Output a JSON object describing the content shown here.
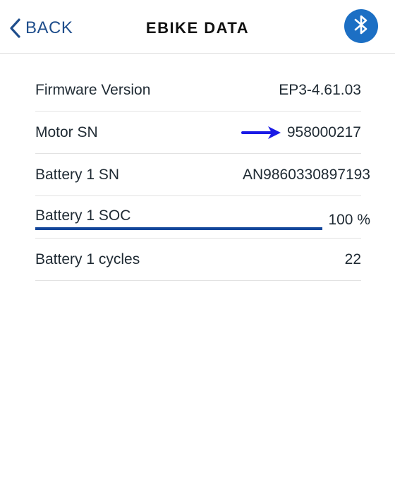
{
  "header": {
    "back_label": "BACK",
    "title": "EBIKE DATA",
    "bluetooth_icon": "bluetooth-icon",
    "accent_color": "#1f4e8c",
    "bluetooth_color": "#1c6fc4"
  },
  "rows": [
    {
      "label": "Firmware Version",
      "value": "EP3-4.61.03"
    },
    {
      "label": "Motor SN",
      "value": "958000217",
      "annotation": "arrow-icon"
    },
    {
      "label": "Battery 1 SN",
      "value": "AN9860330897193"
    },
    {
      "label": "Battery 1 SOC",
      "value": "100 %",
      "level": 1.0
    },
    {
      "label": "Battery 1 cycles",
      "value": "22"
    }
  ],
  "colors": {
    "soc_bar": "#13469a",
    "annotation_arrow": "#1a1ae6",
    "divider": "#e2e2e2"
  }
}
